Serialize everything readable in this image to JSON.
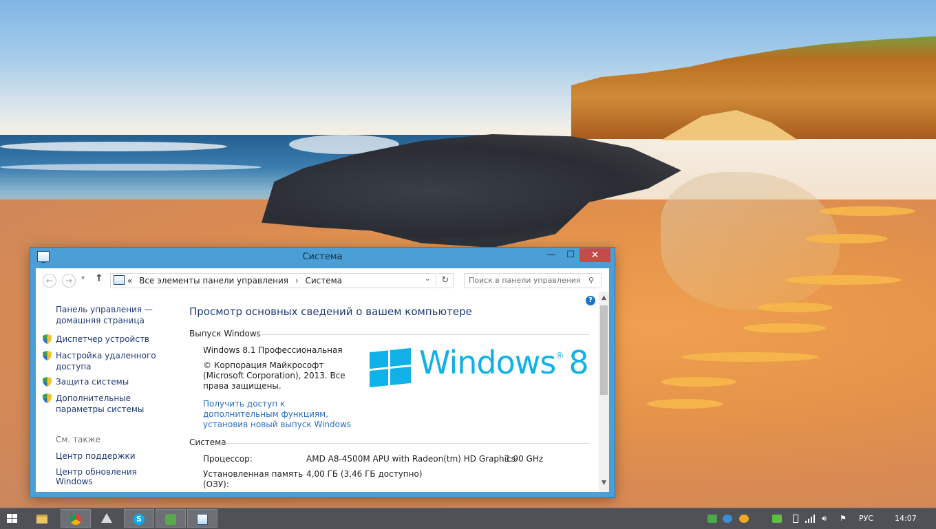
{
  "window": {
    "title": "Система",
    "minimize_glyph": "—",
    "maximize_glyph": "☐",
    "close_glyph": "✕"
  },
  "address": {
    "prefix": "«",
    "crumbs": [
      "Все элементы панели управления",
      "Система"
    ],
    "separator": "›",
    "search_placeholder": "Поиск в панели управления"
  },
  "sidebar": {
    "home_link": "Панель управления — домашняя страница",
    "items": [
      {
        "label": "Диспетчер устройств",
        "icon": "shield-icon"
      },
      {
        "label": "Настройка удаленного доступа",
        "icon": "shield-icon"
      },
      {
        "label": "Защита системы",
        "icon": "shield-icon"
      },
      {
        "label": "Дополнительные параметры системы",
        "icon": "shield-icon"
      }
    ],
    "see_also_label": "См. также",
    "see_also": [
      "Центр поддержки",
      "Центр обновления Windows"
    ]
  },
  "main": {
    "title": "Просмотр основных сведений о вашем компьютере",
    "edition_section": "Выпуск Windows",
    "edition_name": "Windows 8.1 Профессиональная",
    "copyright": "© Корпорация Майкрософт (Microsoft Corporation), 2013. Все права защищены.",
    "upgrade_link": "Получить доступ к дополнительным функциям, установив новый выпуск Windows",
    "logo_text": "Windows",
    "logo_version": "8",
    "logo_trademark": "®",
    "system_section": "Система",
    "rows": [
      {
        "label": "Процессор:",
        "value": "AMD A8-4500M APU with Radeon(tm) HD Graphics",
        "extra": "1.90 GHz"
      },
      {
        "label": "Установленная память (ОЗУ):",
        "value": "4,00 ГБ (3,46 ГБ доступно)"
      }
    ]
  },
  "taskbar": {
    "pinned": [
      "file-explorer-icon",
      "chrome-icon",
      "app-triangle-icon",
      "skype-icon",
      "game-app-icon",
      "control-panel-icon"
    ],
    "tray_language": "РУС",
    "clock": "14:07"
  },
  "colors": {
    "window_frame": "#4aa0d6",
    "close_button": "#c74a4a",
    "link": "#1e3a75",
    "accent_logo": "#10b1e8",
    "taskbar": "#4f5157"
  }
}
